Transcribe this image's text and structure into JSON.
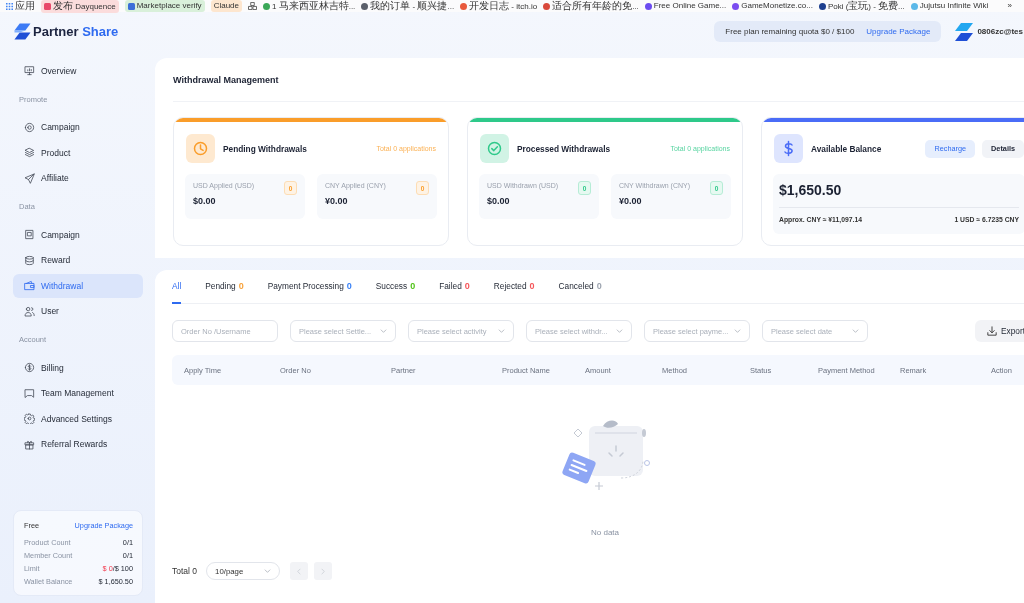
{
  "bookmarks_bar": {
    "items": [
      {
        "kind": "apps",
        "label": "应用"
      },
      {
        "kind": "icon_chip",
        "label": "发布 Dayquence",
        "color": "#fbdcdc"
      },
      {
        "kind": "icon_chip",
        "label": "Marketplace verify",
        "color": "#d9f0da"
      },
      {
        "kind": "chip",
        "label": "Claude",
        "color": "#fde6cf"
      },
      {
        "kind": "groups"
      },
      {
        "kind": "link",
        "label": "1 马来西亚林吉特..."
      },
      {
        "kind": "link",
        "label": "我的订单 - 顺兴捷..."
      },
      {
        "kind": "link",
        "label": "开发日志 - itch.io"
      },
      {
        "kind": "link",
        "label": "适合所有年龄的免..."
      },
      {
        "kind": "link",
        "label": "Free Online Game..."
      },
      {
        "kind": "link",
        "label": "GameMonetize.co..."
      },
      {
        "kind": "link",
        "label": "Poki (宝玩) - 免费..."
      },
      {
        "kind": "link",
        "label": "Jujutsu Infinite Wiki"
      }
    ],
    "overflow": "»"
  },
  "header": {
    "logo": {
      "parts": [
        "Partner",
        "Share"
      ]
    },
    "quota": {
      "text": "Free plan remaining quota $0 / $100",
      "link": "Upgrade Package"
    },
    "user": {
      "email": "0806zc@tes"
    }
  },
  "sidebar": {
    "groups": [
      {
        "items": [
          {
            "label": "Overview",
            "selected": false
          }
        ]
      },
      {
        "heading": "Promote",
        "items": [
          {
            "label": "Campaign",
            "selected": false
          },
          {
            "label": "Product",
            "selected": false
          },
          {
            "label": "Affiliate",
            "selected": false
          }
        ]
      },
      {
        "heading": "Data",
        "items": [
          {
            "label": "Campaign",
            "selected": false
          },
          {
            "label": "Reward",
            "selected": false
          },
          {
            "label": "Withdrawal",
            "selected": true
          },
          {
            "label": "User",
            "selected": false
          }
        ]
      },
      {
        "heading": "Account",
        "items": [
          {
            "label": "Billing",
            "selected": false
          },
          {
            "label": "Team Management",
            "selected": false
          },
          {
            "label": "Advanced Settings",
            "selected": false
          },
          {
            "label": "Referral Rewards",
            "selected": false
          }
        ]
      }
    ],
    "plan": {
      "name": "Free",
      "link": "Upgrade Package",
      "rows": [
        {
          "label": "Product Count",
          "value": "0/1"
        },
        {
          "label": "Member Count",
          "value": "0/1"
        },
        {
          "label": "Limit",
          "used": "$ 0",
          "value": "/$ 100"
        },
        {
          "label": "Wallet Balance",
          "value": "$ 1,650.50"
        }
      ]
    }
  },
  "page_title": "Withdrawal Management",
  "cards": [
    {
      "kind": "status",
      "title": "Pending Withdrawals",
      "total": "Total 0 applications",
      "color": "#fa9d2a",
      "stats": [
        {
          "label": "USD Applied (USD)",
          "count": "0",
          "amount": "$0.00"
        },
        {
          "label": "CNY Applied (CNY)",
          "count": "0",
          "amount": "¥0.00"
        }
      ]
    },
    {
      "kind": "status",
      "title": "Processed Withdrawals",
      "total": "Total 0 applications",
      "color": "#2ec98a",
      "stats": [
        {
          "label": "USD Withdrawn (USD)",
          "count": "0",
          "amount": "$0.00"
        },
        {
          "label": "CNY Withdrawn (CNY)",
          "count": "0",
          "amount": "¥0.00"
        }
      ]
    },
    {
      "kind": "balance",
      "title": "Available Balance",
      "color": "#4a6cf7",
      "buttons": [
        {
          "label": "Recharge",
          "kind": "primary"
        },
        {
          "label": "Details",
          "kind": "secondary"
        }
      ],
      "amount": "$1,650.50",
      "approx": "Approx. CNY ≈ ¥11,097.14",
      "rate": "1 USD ≈ 6.7235 CNY"
    }
  ],
  "tabs": [
    {
      "label": "All",
      "selected": true
    },
    {
      "label": "Pending",
      "count": "0",
      "color": "#f7a23b",
      "selected": false
    },
    {
      "label": "Payment Processing",
      "count": "0",
      "color": "#3b82f6",
      "selected": false
    },
    {
      "label": "Success",
      "count": "0",
      "color": "#52c41a",
      "selected": false
    },
    {
      "label": "Failed",
      "count": "0",
      "color": "#f5565a",
      "selected": false
    },
    {
      "label": "Rejected",
      "count": "0",
      "color": "#f5565a",
      "selected": false
    },
    {
      "label": "Canceled",
      "count": "0",
      "color": "#9ca3af",
      "selected": false
    }
  ],
  "filters": {
    "search": {
      "placeholder": "Order No /Username"
    },
    "selects": [
      {
        "placeholder": "Please select Settle..."
      },
      {
        "placeholder": "Please select activity"
      },
      {
        "placeholder": "Please select withdr..."
      },
      {
        "placeholder": "Please select payme..."
      },
      {
        "placeholder": "Please select date"
      }
    ],
    "export": "Export"
  },
  "table": {
    "columns": [
      "Apply Time",
      "Order No",
      "Partner",
      "Product Name",
      "Amount",
      "Method",
      "Status",
      "Payment Method",
      "Remark",
      "Action"
    ],
    "empty_text": "No data"
  },
  "pagination": {
    "total": "Total 0",
    "page_size": "10/page",
    "prev": {
      "disabled": true
    },
    "next": {
      "disabled": true
    }
  }
}
